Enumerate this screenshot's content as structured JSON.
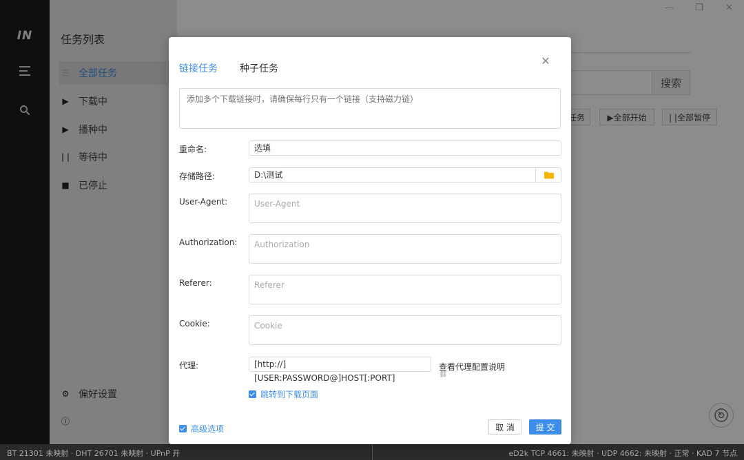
{
  "rail": {
    "logo": "IN"
  },
  "sidebar": {
    "title": "任务列表",
    "items": [
      {
        "label": "全部任务",
        "icon": "list-icon",
        "active": true
      },
      {
        "label": "下载中",
        "icon": "play-icon"
      },
      {
        "label": "播种中",
        "icon": "play-icon"
      },
      {
        "label": "等待中",
        "icon": "pause-icon"
      },
      {
        "label": "已停止",
        "icon": "stop-icon"
      }
    ],
    "settings_label": "偏好设置"
  },
  "main": {
    "search_label": "搜索",
    "task_btn_label": "任务",
    "start_all_label": "▶全部开始",
    "pause_all_label": "| |全部暂停"
  },
  "statusbar": {
    "left": "BT 21301 未映射 · DHT 26701 未映射 · UPnP 开",
    "right": "eD2k TCP 4661: 未映射 · UDP 4662: 未映射 · 正常 · KAD 7 节点"
  },
  "dialog": {
    "tab_links": "链接任务",
    "tab_torrent": "种子任务",
    "links_placeholder": "添加多个下载链接时，请确保每行只有一个链接（支持磁力链）",
    "rename_label": "重命名:",
    "rename_value": "选填",
    "path_label": "存储路径:",
    "path_value": "D:\\测试",
    "ua_label": "User-Agent:",
    "ua_placeholder": "User-Agent",
    "auth_label": "Authorization:",
    "auth_placeholder": "Authorization",
    "referer_label": "Referer:",
    "referer_placeholder": "Referer",
    "cookie_label": "Cookie:",
    "cookie_placeholder": "Cookie",
    "proxy_label": "代理:",
    "proxy_value": "[http://][USER:PASSWORD@]HOST[:PORT]",
    "proxy_help": "查看代理配置说明",
    "jump_label": "跳转到下载页面",
    "advanced_label": "高级选项",
    "cancel_label": "取 消",
    "submit_label": "提 交"
  },
  "colors": {
    "accent": "#3d8ee8",
    "rail": "#1c1c1e",
    "sidebar": "#e9e9e9"
  }
}
